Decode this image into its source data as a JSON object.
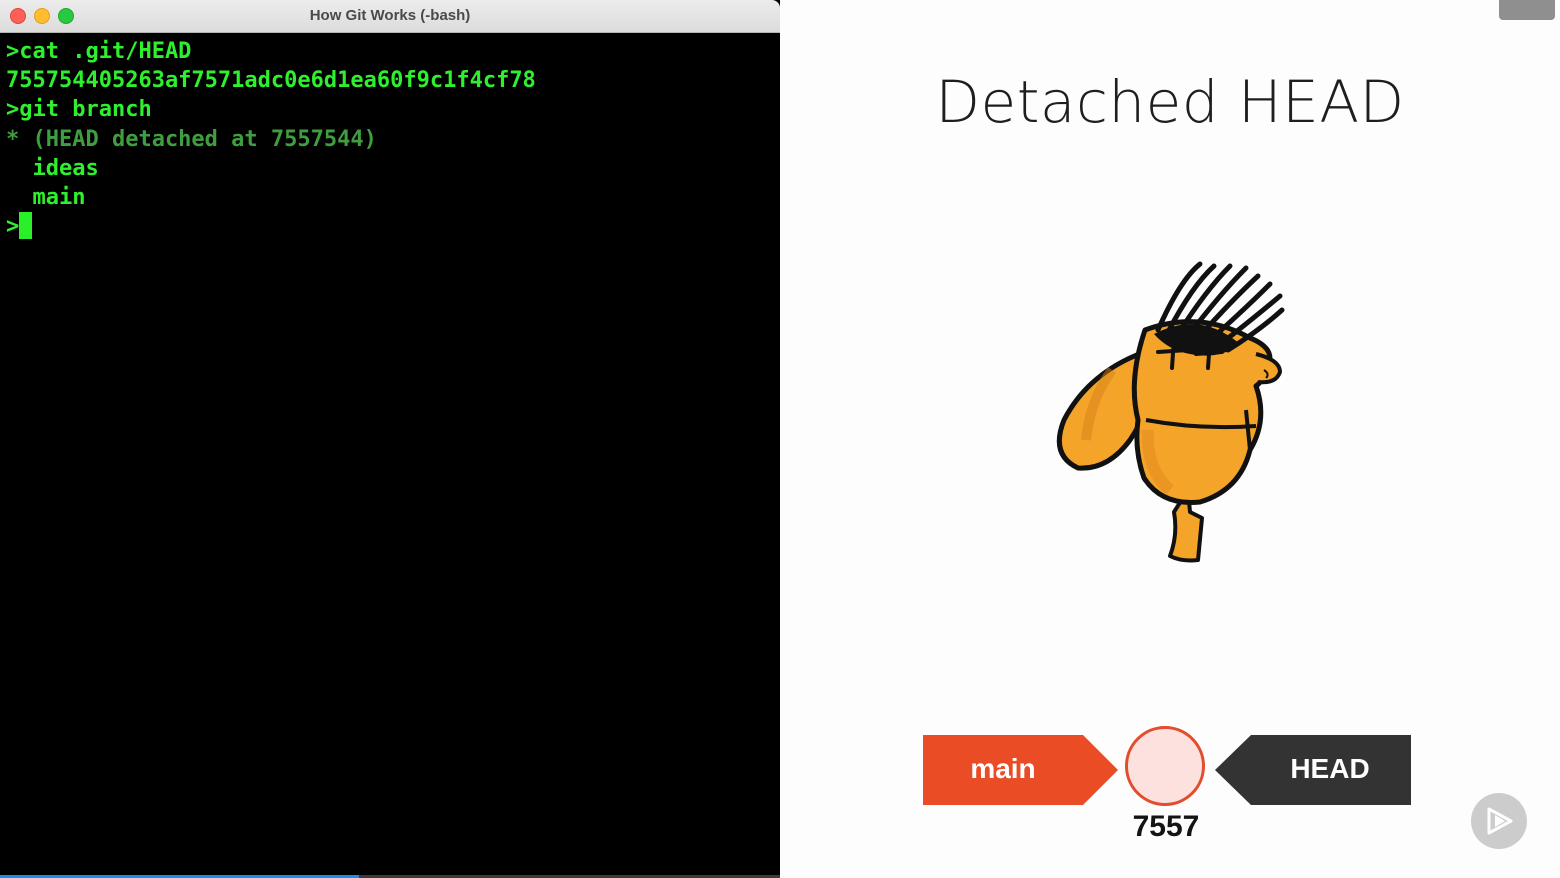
{
  "window": {
    "title": "How Git Works (-bash)"
  },
  "terminal": {
    "lines": [
      ">cat .git/HEAD",
      "755754405263af7571adc0e6d1ea60f9c1f4cf78",
      ">git branch",
      "* (HEAD detached at 7557544)",
      "  ideas",
      "  main"
    ],
    "prompt": ">",
    "progress_percent": 46,
    "colors": {
      "text": "#2ef02e",
      "dim_text": "#3f9e3f",
      "background": "#000000"
    }
  },
  "slide": {
    "title": "Detached HEAD",
    "branch_main_label": "main",
    "branch_head_label": "HEAD",
    "commit_label": "7557",
    "character_icon": "detached-head-character",
    "colors": {
      "main_branch": "#ea4c25",
      "head_branch": "#333333",
      "commit_fill": "#fde1df",
      "commit_stroke": "#e24d2d"
    }
  },
  "controls": {
    "menu_icon": "hamburger-icon",
    "play_icon": "play-icon"
  }
}
